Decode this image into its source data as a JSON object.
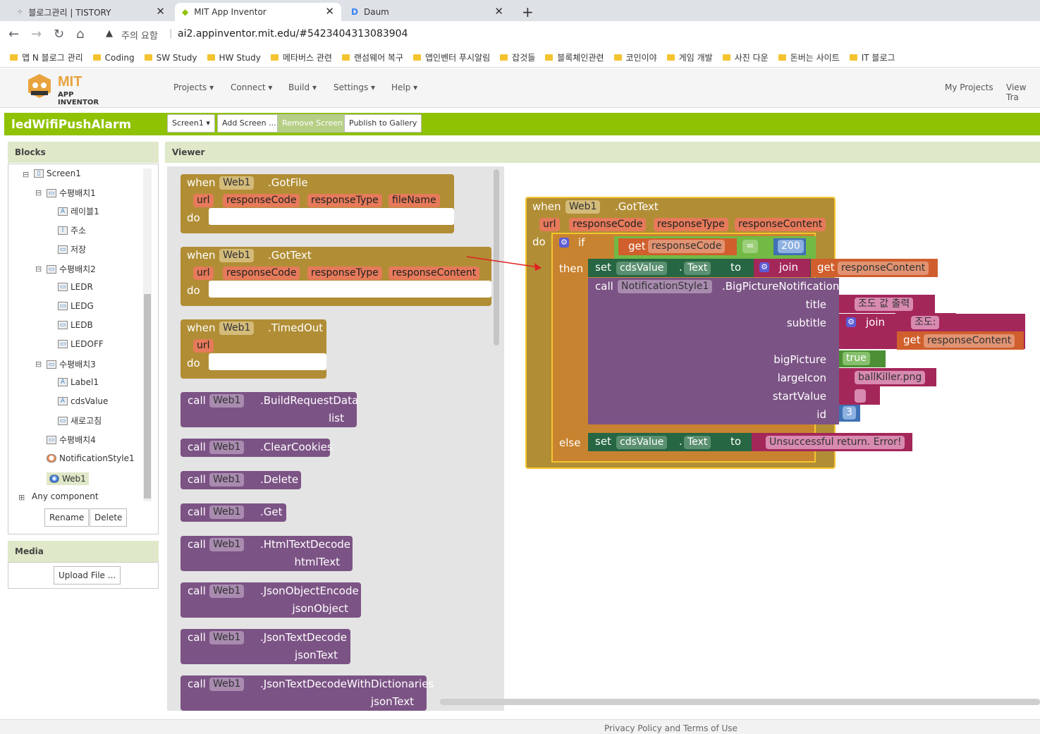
{
  "browser": {
    "tabs": [
      {
        "title": "블로그관리 | TISTORY"
      },
      {
        "title": "MIT App Inventor"
      },
      {
        "title": "Daum"
      }
    ],
    "security_label": "주의 요함",
    "url": "ai2.appinventor.mit.edu/#5423404313083904",
    "bookmarks": [
      "앱 N 블로그 관리",
      "Coding",
      "SW Study",
      "HW Study",
      "메타버스 관련",
      "랜섬웨어 복구",
      "앱인벤터 푸시알림",
      "잡것들",
      "블록체인관련",
      "코인이야",
      "게임 개발",
      "사진 다운",
      "돈버는 사이트",
      "IT 블로그"
    ]
  },
  "app": {
    "logo_title": "MIT",
    "logo_subtitle": "APP INVENTOR",
    "menu": [
      "Projects ▾",
      "Connect ▾",
      "Build ▾",
      "Settings ▾",
      "Help ▾"
    ],
    "right_menu": [
      "My Projects",
      "View Tra"
    ],
    "project_name": "ledWifiPushAlarm",
    "buttons": {
      "screen": "Screen1 ▾",
      "add_screen": "Add Screen ...",
      "remove_screen": "Remove Screen",
      "publish": "Publish to Gallery"
    }
  },
  "blocks_panel": {
    "title": "Blocks",
    "tree": [
      "Screen1",
      "수평배치1",
      "레이블1",
      "주소",
      "저장",
      "수평배치2",
      "LEDR",
      "LEDG",
      "LEDB",
      "LEDOFF",
      "수평배치3",
      "Label1",
      "cdsValue",
      "새로고침",
      "수평배치4",
      "NotificationStyle1",
      "Web1",
      "Any component"
    ],
    "rename": "Rename",
    "delete": "Delete"
  },
  "media_panel": {
    "title": "Media",
    "upload": "Upload File ..."
  },
  "viewer_title": "Viewer",
  "palette": {
    "gotfile": {
      "when": "when",
      "comp": "Web1",
      "event": ".GotFile",
      "params": [
        "url",
        "responseCode",
        "responseType",
        "fileName"
      ],
      "do": "do"
    },
    "gottext": {
      "when": "when",
      "comp": "Web1",
      "event": ".GotText",
      "params": [
        "url",
        "responseCode",
        "responseType",
        "responseContent"
      ],
      "do": "do"
    },
    "timedout": {
      "when": "when",
      "comp": "Web1",
      "event": ".TimedOut",
      "params": [
        "url"
      ],
      "do": "do"
    },
    "calls": [
      {
        "call": "call",
        "comp": "Web1",
        "method": ".BuildRequestData",
        "arg": "list"
      },
      {
        "call": "call",
        "comp": "Web1",
        "method": ".ClearCookies",
        "arg": ""
      },
      {
        "call": "call",
        "comp": "Web1",
        "method": ".Delete",
        "arg": ""
      },
      {
        "call": "call",
        "comp": "Web1",
        "method": ".Get",
        "arg": ""
      },
      {
        "call": "call",
        "comp": "Web1",
        "method": ".HtmlTextDecode",
        "arg": "htmlText"
      },
      {
        "call": "call",
        "comp": "Web1",
        "method": ".JsonObjectEncode",
        "arg": "jsonObject"
      },
      {
        "call": "call",
        "comp": "Web1",
        "method": ".JsonTextDecode",
        "arg": "jsonText"
      },
      {
        "call": "call",
        "comp": "Web1",
        "method": ".JsonTextDecodeWithDictionaries",
        "arg": "jsonText"
      }
    ]
  },
  "workspace": {
    "when": "when",
    "comp": "Web1",
    "event": ".GotText",
    "params": [
      "url",
      "responseCode",
      "responseType",
      "responseContent"
    ],
    "do": "do",
    "if": "if",
    "then": "then",
    "else": "else",
    "get": "get",
    "responseCode": "responseCode",
    "eq": "=",
    "num200": "200",
    "set": "set",
    "cdsValue": "cdsValue",
    "dot": ".",
    "Text": "Text",
    "to": "to",
    "join": "join",
    "responseContent": "responseContent",
    "call": "call",
    "notif": "NotificationStyle1",
    "notif_method": ".BigPictureNotification",
    "arg_labels": [
      "title",
      "subtitle",
      "bigPicture",
      "largeIcon",
      "startValue",
      "id"
    ],
    "title_text": "조도 값 출력",
    "subtitle_text": "조도:",
    "true_val": "true",
    "largeicon_text": "ballKiller.png",
    "id_val": "3",
    "error_text": "Unsuccessful return. Error!"
  },
  "footer": "Privacy Policy and Terms of Use"
}
